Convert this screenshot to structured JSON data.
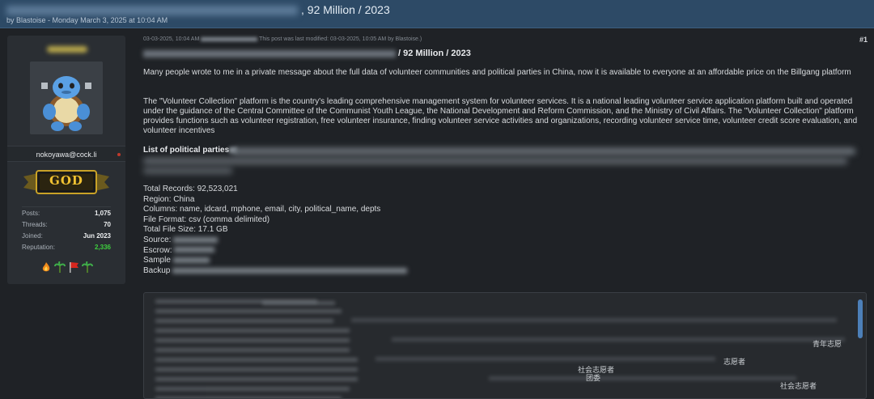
{
  "thread": {
    "title_suffix": ", 92 Million / 2023",
    "byline_prefix": "by",
    "byline": "Blastoise - Monday March 3, 2025 at 10:04 AM"
  },
  "user": {
    "email": "nokoyawa@cock.li",
    "rank": "GOD",
    "stats": [
      {
        "label": "Posts:",
        "value": "1,075"
      },
      {
        "label": "Threads:",
        "value": "70"
      },
      {
        "label": "Joined:",
        "value": "Jun 2023"
      },
      {
        "label": "Reputation:",
        "value": "2,336"
      }
    ],
    "awards": [
      "flame-award-icon",
      "palm-award-icon",
      "flag-award-icon",
      "palm-award-icon"
    ]
  },
  "post": {
    "number": "#1",
    "meta_prefix": "03-03-2025, 10:04 AM",
    "meta_suffix": "This post was last modified: 03-03-2025, 10:05 AM by Blastoise.)",
    "heading_suffix": "/ 92 Million / 2023",
    "para1": "Many people wrote to me in a private message about the full data of volunteer communities and political parties in China, now it is available to everyone at an affordable price on the Billgang platform",
    "para2": "The \"Volunteer Collection\" platform is the country's leading comprehensive management system for volunteer services. It is a national leading volunteer service application platform built and operated under the guidance of the Central Committee of the Communist Youth League, the National Development and Reform Commission, and the Ministry of Civil Affairs. The \"Volunteer Collection\" platform provides functions such as volunteer registration, free volunteer insurance, finding volunteer service activities and organizations, recording volunteer service time, volunteer credit score evaluation, and volunteer incentives",
    "list_heading": "List of political parties",
    "details": [
      "Total Records: 92,523,021",
      "Region: China",
      "Columns: name, idcard, mphone, email, city, political_name, depts",
      "File Format: csv (comma delimited)",
      "Total File Size: 17.1 GB"
    ],
    "redacted_labels": [
      "Source:",
      "Escrow:",
      "Sample",
      "Backup"
    ]
  },
  "code_visible": [
    "社会志愿者",
    "社会志愿者",
    "团委",
    "青年志愿",
    "志愿者"
  ],
  "colors": {
    "header_bg": "#2d4a66",
    "page_bg": "#1f2226",
    "panel_bg": "#2a2e33",
    "rank_gold": "#f1c232",
    "reputation_green": "#3ecf3e",
    "scrollbar": "#4c7fb8"
  }
}
